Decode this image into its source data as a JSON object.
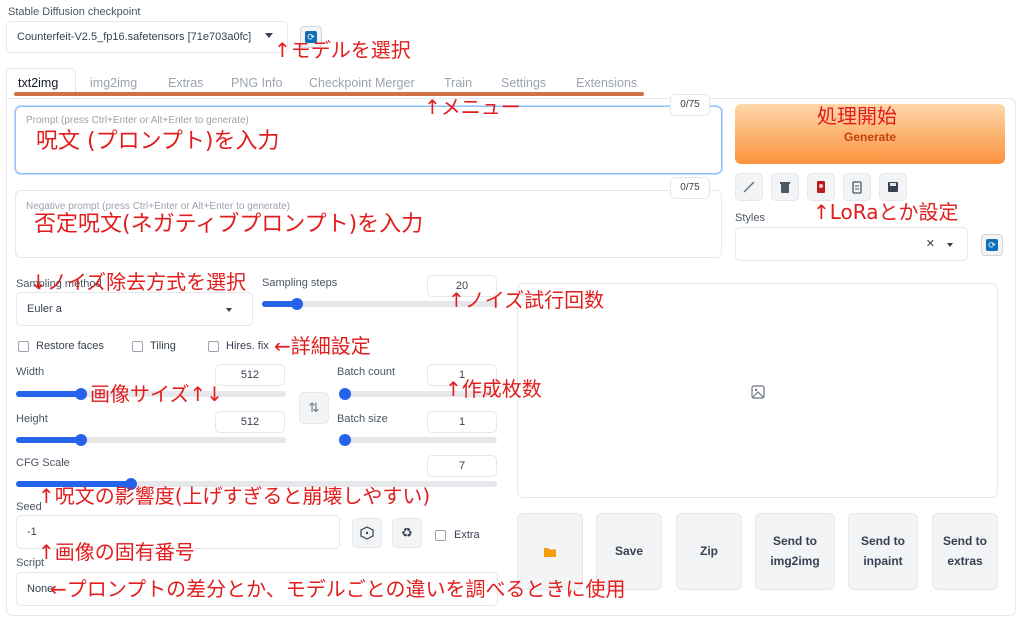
{
  "checkpoint": {
    "label": "Stable Diffusion checkpoint",
    "value": "Counterfeit-V2.5_fp16.safetensors [71e703a0fc]"
  },
  "tabs": [
    "txt2img",
    "img2img",
    "Extras",
    "PNG Info",
    "Checkpoint Merger",
    "Train",
    "Settings",
    "Extensions"
  ],
  "prompt": {
    "placeholder": "Prompt (press Ctrl+Enter or Alt+Enter to generate)",
    "counter": "0/75"
  },
  "negative_prompt": {
    "placeholder": "Negative prompt (press Ctrl+Enter or Alt+Enter to generate)",
    "counter": "0/75"
  },
  "generate_label": "Generate",
  "styles_label": "Styles",
  "sampling_method": {
    "label": "Sampling method",
    "value": "Euler a"
  },
  "sampling_steps": {
    "label": "Sampling steps",
    "value": "20",
    "fraction": 0.15
  },
  "checkboxes": {
    "restore_faces": "Restore faces",
    "tiling": "Tiling",
    "hires_fix": "Hires. fix"
  },
  "width": {
    "label": "Width",
    "value": "512",
    "fraction": 0.24
  },
  "height": {
    "label": "Height",
    "value": "512",
    "fraction": 0.24
  },
  "batch_count": {
    "label": "Batch count",
    "value": "1",
    "fraction": 0.0
  },
  "batch_size": {
    "label": "Batch size",
    "value": "1",
    "fraction": 0.0
  },
  "cfg_scale": {
    "label": "CFG Scale",
    "value": "7",
    "fraction": 0.24
  },
  "seed": {
    "label": "Seed",
    "value": "-1",
    "extra_label": "Extra"
  },
  "script": {
    "label": "Script",
    "value": "None"
  },
  "output_buttons": {
    "save": "Save",
    "zip": "Zip",
    "send_img2img": "Send to img2img",
    "send_inpaint": "Send to inpaint",
    "send_extras": "Send to extras"
  },
  "annotations": {
    "model_select": "↑モデルを選択",
    "menu": "↑メニュー",
    "generate_start": "処理開始",
    "prompt_input": "呪文 (プロンプト)を入力",
    "negative_input": "否定呪文(ネガティブプロンプト)を入力",
    "lora_setting": "↑LoRaとか設定",
    "sampler": "↓ノイズ除去方式を選択",
    "steps": "↑ノイズ試行回数",
    "detail": "←詳細設定",
    "image_size": "画像サイズ↑↓",
    "batch": "↑作成枚数",
    "cfg": "↑呪文の影響度(上げすぎると崩壊しやすい)",
    "seed": "↑画像の固有番号",
    "script": "←プロンプトの差分とか、モデルごとの違いを調べるときに使用"
  },
  "colors": {
    "accent": "#2563eb",
    "generate_from": "#fed7aa",
    "generate_to": "#fb923c",
    "annotation": "#e11d1d"
  }
}
